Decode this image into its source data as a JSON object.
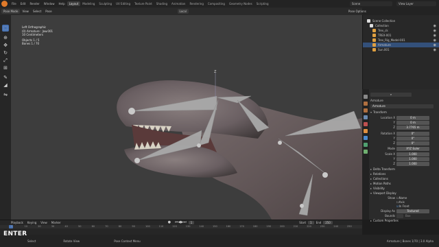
{
  "menu": {
    "items": [
      "File",
      "Edit",
      "Render",
      "Window",
      "Help"
    ],
    "workspaces": [
      "Layout",
      "Modeling",
      "Sculpting",
      "UV Editing",
      "Texture Paint",
      "Shading",
      "Animation",
      "Rendering",
      "Compositing",
      "Geometry Nodes",
      "Scripting"
    ],
    "active_workspace": "Layout",
    "scene": "Scene",
    "view_layer": "View Layer"
  },
  "header": {
    "mode": "Pose Mode",
    "menus": [
      "View",
      "Select",
      "Pose"
    ],
    "orientation": "Local",
    "pose_options": "Pose Options"
  },
  "viewport_info": {
    "view": "Left Orthographic",
    "object": "(0) Armature : Jaw.001",
    "units": "10 Centimeters",
    "objects": "Objects    1 / 5",
    "bones": "Bones      1 / 70"
  },
  "outliner": {
    "rows": [
      "Scene Collection",
      "Collection",
      "Trex_ck",
      "TREX-001",
      "Trex_Rig_Model-001",
      "Armature",
      "Sun.001"
    ]
  },
  "properties": {
    "search_placeholder": "",
    "object_name": "Armature",
    "bone_name": "Armature",
    "transform_label": "Transform",
    "location_label": "Location X",
    "location": [
      "0 m",
      "0 m",
      "3.7765 m"
    ],
    "rotation_label": "Rotation X",
    "rotation": [
      "0°",
      "0°",
      "0°"
    ],
    "mode_label": "Mode",
    "mode_value": "XYZ Euler",
    "scale_label": "Scale X",
    "scale": [
      "1.000",
      "1.000",
      "1.000"
    ],
    "axis_y": "Y",
    "axis_z": "Z",
    "panels": [
      "Delta Transform",
      "Relations",
      "Collections",
      "Motion Paths",
      "Visibility",
      "Viewport Display"
    ],
    "show_label": "Show",
    "show_opts": [
      "Name",
      "Axis",
      "In Front"
    ],
    "display_as_label": "Display As",
    "display_as": "Textured",
    "bounds_label": "Bounds",
    "bounds_value": "Box",
    "custom_props": "Custom Properties"
  },
  "timeline": {
    "menus": [
      "Playback",
      "Keying",
      "View",
      "Marker"
    ],
    "current_frame": "1",
    "start_label": "Start",
    "start": "1",
    "end_label": "End",
    "end": "250",
    "ticks": [
      "0",
      "10",
      "20",
      "30",
      "40",
      "50",
      "60",
      "70",
      "80",
      "90",
      "100",
      "110",
      "120",
      "130",
      "140",
      "150",
      "160",
      "170",
      "180",
      "190",
      "200",
      "210",
      "220",
      "230",
      "240",
      "250"
    ]
  },
  "status": {
    "select": "Select",
    "rotate": "Rotate View",
    "context": "Pose Context Menu",
    "info": "Armature | Bones 1/70 | 3.0 Alpha"
  },
  "overlay_key": "ENTER"
}
